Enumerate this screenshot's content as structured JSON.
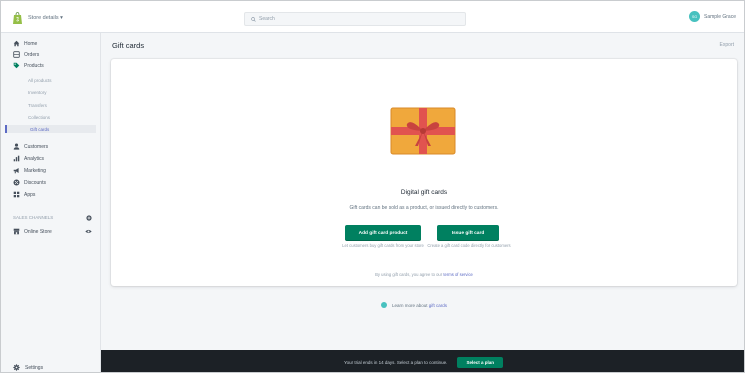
{
  "topbar": {
    "store_name": "Store details ▾",
    "search_placeholder": "Search",
    "user_initials": "SG",
    "user_name": "Sample Grace"
  },
  "sidebar": {
    "items": [
      {
        "label": "Home",
        "icon": "home-icon"
      },
      {
        "label": "Orders",
        "icon": "orders-icon"
      },
      {
        "label": "Products",
        "icon": "tag-icon"
      },
      {
        "label": "Customers",
        "icon": "person-icon"
      },
      {
        "label": "Analytics",
        "icon": "bar-chart-icon"
      },
      {
        "label": "Marketing",
        "icon": "megaphone-icon"
      },
      {
        "label": "Discounts",
        "icon": "discount-icon"
      },
      {
        "label": "Apps",
        "icon": "apps-icon"
      }
    ],
    "product_subitems": [
      "All products",
      "Inventory",
      "Transfers",
      "Collections",
      "Gift cards"
    ],
    "active_subitem": "Gift cards",
    "sales_channels_heading": "SALES CHANNELS",
    "online_store_label": "Online Store",
    "settings_label": "Settings"
  },
  "main": {
    "page_title": "Gift cards",
    "export_label": "Export",
    "card": {
      "heading": "Digital gift cards",
      "subheading": "Gift cards can be sold as a product, or issued directly to customers.",
      "add_button": "Add gift card product",
      "issue_button": "Issue gift card",
      "add_help": "Let customers buy gift cards from your store",
      "issue_help": "Create a gift card code directly for customers",
      "terms_prefix": "By using gift cards, you agree to our",
      "terms_link": "terms of service"
    },
    "learn_prefix": "Learn more about",
    "learn_link": "gift cards"
  },
  "banner": {
    "message": "Your trial ends in 14 days. Select a plan to continue.",
    "button": "Select a plan"
  },
  "colors": {
    "primary_green": "#008060",
    "accent_indigo": "#5c6ac4",
    "teal": "#47c1bf",
    "gift_orange": "#f0a83c",
    "ribbon_red": "#e1534f"
  }
}
